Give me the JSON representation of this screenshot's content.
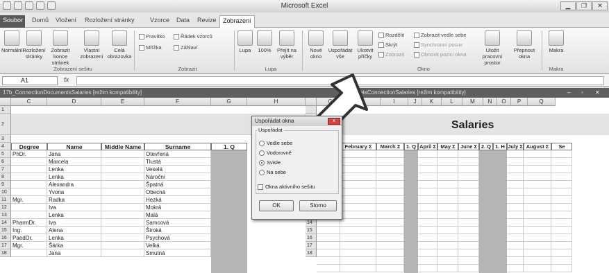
{
  "app_title": "Microsoft Excel",
  "window_controls": {
    "minimize": "▁",
    "restore": "❐",
    "close": "✕"
  },
  "tabs": [
    {
      "label": "Soubor"
    },
    {
      "label": "Domů"
    },
    {
      "label": "Vložení"
    },
    {
      "label": "Rozložení stránky"
    },
    {
      "label": "Vzorce"
    },
    {
      "label": "Data"
    },
    {
      "label": "Revize"
    },
    {
      "label": "Zobrazení"
    }
  ],
  "ribbon": {
    "normalni": "Normální",
    "rozlozeni_stranky": "Rozložení stránky",
    "zobrazit_konce": "Zobrazit konce stránek",
    "vlastni_zobrazeni": "Vlastní zobrazení",
    "cela_obrazovka": "Celá obrazovka",
    "group_zobrazeni_sesitu": "Zobrazení sešitu",
    "pravitko": "Pravítko",
    "radek_vzorcu": "Řádek vzorců",
    "mrizka": "Mřížka",
    "zahlavi": "Záhlaví",
    "group_zobrazit": "Zobrazit",
    "lupa": "Lupa",
    "lupa_100": "100%",
    "prejit_na_vyber": "Přejít na výběr",
    "group_lupa": "Lupa",
    "nove_okno": "Nové okno",
    "usporadat_vse": "Uspořádat vše",
    "ukotvit_pricky": "Ukotvit příčky",
    "rozdelit": "Rozdělit",
    "skryt": "Skrýt",
    "zobrazit": "Zobrazit",
    "zobrazit_vedle_sebe": "Zobrazit vedle sebe",
    "synchronni_posuv": "Synchronní posuv",
    "obnovit_pozici": "Obnovit pozici okna",
    "ulozit_pracovni_prostor": "Uložit pracovní prostor",
    "prepnout_okna": "Přepnout okna",
    "group_okno": "Okno",
    "makra": "Makra",
    "group_makra": "Makra"
  },
  "formula_bar": {
    "name_box": "A1",
    "fx": "fx",
    "value": ""
  },
  "window1": {
    "title": "17b_ConnectionDocumentsSalaries  [režim kompatibility]",
    "columns": [
      "C",
      "D",
      "E",
      "F",
      "G",
      "H"
    ],
    "row_numbers": [
      "1",
      "2",
      "3",
      "4",
      "5",
      "6",
      "7",
      "8",
      "9",
      "10",
      "11",
      "12",
      "13",
      "14",
      "15",
      "16",
      "17",
      "18"
    ],
    "headers": [
      "Degree",
      "Name",
      "Middle Name",
      "Surname",
      "1. Q"
    ],
    "rows": [
      [
        "PhDr.",
        "Jana",
        "",
        "Otevřená"
      ],
      [
        "",
        "Marcela",
        "",
        "Tlustá"
      ],
      [
        "",
        "Lenka",
        "",
        "Veselá"
      ],
      [
        "",
        "Lenka",
        "",
        "Nároční"
      ],
      [
        "",
        "Alexandra",
        "",
        "Špatná"
      ],
      [
        "",
        "Yvona",
        "",
        "Obecná"
      ],
      [
        "Mgr.",
        "Radka",
        "",
        "Hezká"
      ],
      [
        "",
        "Iva",
        "",
        "Mokrá"
      ],
      [
        "",
        "Lenka",
        "",
        "Malá"
      ],
      [
        "PharmDr.",
        "Iva",
        "",
        "Samcová"
      ],
      [
        "Ing.",
        "Alena",
        "",
        "Široká"
      ],
      [
        "PaedDr.",
        "Lenka",
        "",
        "Psychová"
      ],
      [
        "Mgr.",
        "Šárka",
        "",
        "Velká"
      ],
      [
        "",
        "Jana",
        "",
        "Smutná"
      ]
    ]
  },
  "window2": {
    "title": "SheetsConnectionSalaries  [režim kompatibility]",
    "columns": [
      "G",
      "H",
      "I",
      "J",
      "K",
      "L",
      "M",
      "N",
      "O",
      "P",
      "Q"
    ],
    "salaries_title": "Salaries",
    "headers": [
      "ary Σ",
      "February Σ",
      "March Σ",
      "1. Q",
      "April Σ",
      "May Σ",
      "June Σ",
      "2. Q",
      "1. H",
      "July Σ",
      "August Σ",
      "Se"
    ],
    "row_numbers": [
      "13",
      "14",
      "15",
      "16",
      "17",
      "18"
    ]
  },
  "dialog": {
    "title": "Uspořádat okna",
    "close": "x",
    "group_label": "Uspořádat",
    "options": [
      {
        "label": "Vedle sebe",
        "selected": false
      },
      {
        "label": "Vodorovně",
        "selected": false
      },
      {
        "label": "Svisle",
        "selected": true
      },
      {
        "label": "Na sebe",
        "selected": false
      }
    ],
    "checkbox": "Okna aktivního sešitu",
    "ok": "OK",
    "cancel": "Storno"
  }
}
